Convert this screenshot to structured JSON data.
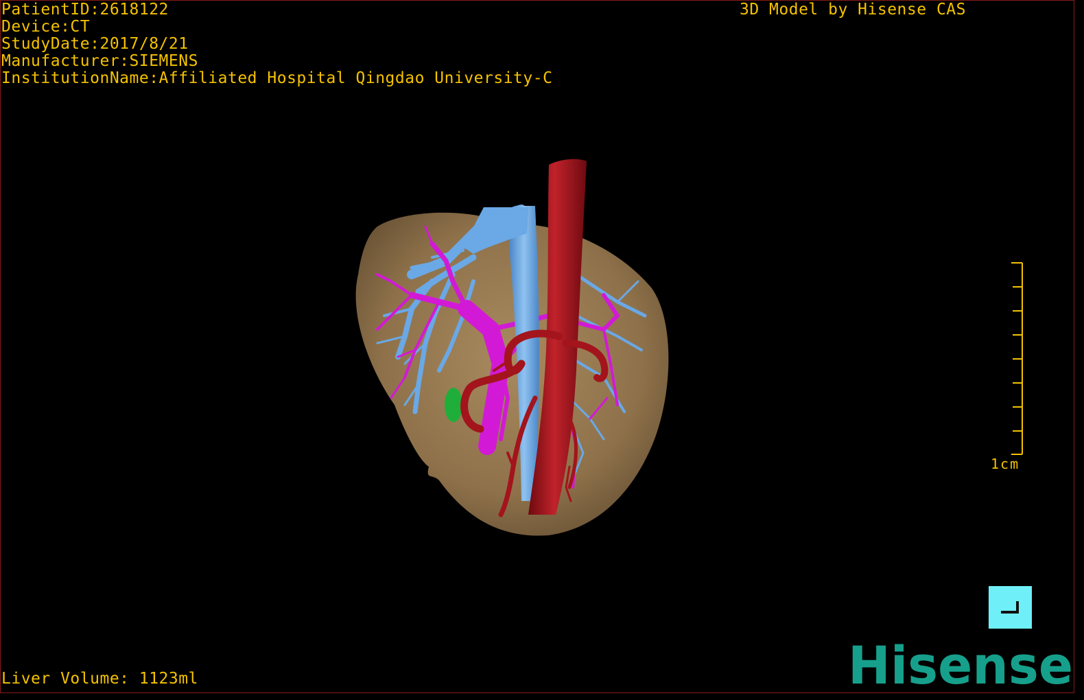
{
  "patient_info": {
    "patient_id": "PatientID:2618122",
    "device": "Device:CT",
    "study_date": "StudyDate:2017/8/21",
    "manufacturer": "Manufacturer:SIEMENS",
    "institution": "InstitutionName:Affiliated Hospital Qingdao University-C"
  },
  "header": {
    "title": "3D Model by Hisense CAS"
  },
  "footer": {
    "liver_volume": "Liver Volume: 1123ml"
  },
  "scale": {
    "label": "1cm"
  },
  "logo": {
    "text": "Hisense"
  },
  "colors": {
    "text": "#f5c200",
    "liver": "#9c7e55",
    "hepatic_vein": "#6aa8e6",
    "portal_vein": "#d21ad6",
    "artery": "#a3141c",
    "gallbladder": "#1fae3a",
    "button": "#6ff0f8",
    "logo": "#16a08c"
  },
  "icons": {
    "corner_button": "corner-arrow-icon"
  }
}
